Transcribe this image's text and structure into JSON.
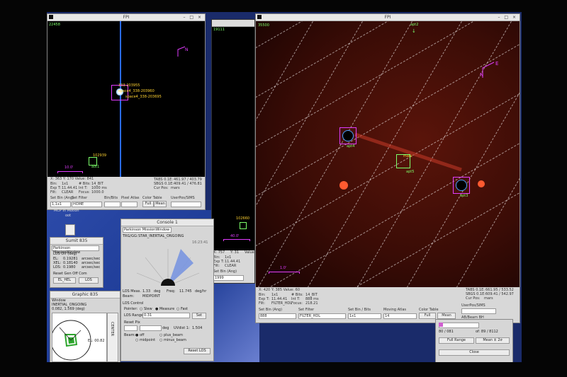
{
  "windows": {
    "fpi_left": {
      "title": "FPI",
      "counter": "22458",
      "targets": [
        "333-203955",
        "space4_338-203960",
        "space4_338-203695"
      ],
      "marker_a": "102939",
      "marker_b": "aot1",
      "scale": "10.0'",
      "info_line": "X:  363      Y:  170      Value: 841",
      "sbin": "Bin:",
      "sbin_val": "1x1",
      "sbits": "# Bits:",
      "sbits_val": "14_BIT",
      "sexp": "Exp T:",
      "sexp_val": "11.44.41",
      "sint": "Int T:",
      "sint_val": "1000 ms",
      "sfil": "Filt:",
      "sfil_val": "CLEAR",
      "sfocus": "Focus:",
      "sfocus_val": "1000.0",
      "sbj": "Cur Pos:",
      "sbj_val": "mars",
      "ra": "TABS 0.1E:",
      "ra_val": "461.97 / 403.79",
      "dec": "SBGS 0.1E:",
      "dec_val": "409.41 / 476.81",
      "set_bin": "Set Bin (Ang)",
      "set_bin_val": "1,1x1",
      "set_filter": "Set Filter",
      "set_filter_val": "HOME",
      "bin_bits": "Bin/Bits",
      "pixel": "Pixel Atlas",
      "color_table": "Color Table",
      "full": "Full",
      "mean": "Mean",
      "userpos": "UserPos/SIMS",
      "scroll": "MCP In Motion",
      "scroll2": "oot"
    },
    "narrow": {
      "counter": "19111",
      "marker_a": "102660",
      "scale": "40.0'",
      "x": "X:  757",
      "y": "Y:  31",
      "v": "Value",
      "bin": "Bin:",
      "bin_val": "1x1",
      "exp": "Exp T:",
      "exp_val": "11.44.41",
      "fil": "Filt:",
      "fil_val": "CLEAR",
      "set_bin": "Set Bin (Ang)",
      "set_bin_val": "1999"
    },
    "fpi_right": {
      "title": "FPI",
      "counter": "35500",
      "top_label": "apt2",
      "targets": [
        "apt4",
        "apt5",
        "apt3"
      ],
      "target_mars": "mars",
      "scale": "1.0'",
      "info_line": "X:  420      Y:  385      Value: 60",
      "bin": "Bin:",
      "bin_val": "1x1",
      "bits": "# Bits:",
      "bits_val": "14_BIT",
      "exp": "Exp T:",
      "exp_val": "11.44.41",
      "int": "Int T:",
      "int_val": "888 ms",
      "fil": "Filt:",
      "fil_val": "FILTER_HDL",
      "focus": "Focus:",
      "focus_val": "218.21",
      "ra": "TABS 0.1E:",
      "ra_val": "661.95 / 533.52",
      "dec": "SBGS 0.1E:",
      "dec_val": "609.41 / 542.97",
      "cur": "Cur Pos:",
      "cur_val": "mars",
      "set_bin": "Set Bin (Ang)",
      "set_bin_val": "888",
      "set_filter": "Set Filter",
      "set_filter_val": "FILTER_HDL",
      "bin_bits": "Set Bin / Bits",
      "bin_bits_val": "1x1",
      "moving": "Moving Atlas",
      "moving_val": "14",
      "color_table": "Color Table",
      "full": "Full",
      "mean": "Mean",
      "userpos": "UserPos/SIMS",
      "ab": "AB/Beam BH"
    },
    "console": {
      "title": "Console 1",
      "dropdown": "Parkinson MissionWindow",
      "lqs": "TRG/GG:",
      "lqs_val": "STAR_INERTIAL_ONGOING",
      "time": "16:23:41",
      "meas": "LOS Meas.",
      "meas_val": "1.33",
      "deg": "deg",
      "freq": "Freq:",
      "freq_val": "11.745",
      "freq_unit": "deg/hr",
      "beam": "Beam:",
      "beam_val": "MIDPOINT",
      "los": "LOS Control",
      "pointer": "Pointer:",
      "slew": "Slew",
      "measure": "Measure",
      "fast": "Fast",
      "range": "LOS Range",
      "range_val": "0.31",
      "set": "Set",
      "reset_pix": "Reset Pix",
      "beam2": "Beam:",
      "off": "off",
      "plus_beam": "plus_beam",
      "midpoint": "midpoint",
      "minus_beam": "minus_beam",
      "deg2": "deg",
      "uvdist": "UVdist 1:",
      "uvdist_val": "1.504",
      "reset_los": "Reset LOS"
    },
    "small": {
      "title": "Sumit 835",
      "dropdown": "Parkinson MissionWindow",
      "head": "LOS Off (deg)",
      "rows": [
        {
          "k": "EL:",
          "v": "0.19281",
          "u": "arcsec/sec"
        },
        {
          "k": "XEL:",
          "v": "0.18140",
          "u": "arcsec/sec"
        },
        {
          "k": "LOS:",
          "v": "0.1980",
          "u": "arcsec/sec"
        }
      ],
      "reset": "Reset Gen Off Com",
      "btn1": "EL_HEL",
      "btn2": "LOS"
    },
    "graphic": {
      "title": "Graphic 835",
      "win": "Window",
      "ongoing": "INERTIAL_ONGOING",
      "coords": "0.082, 1.569 (deg)",
      "el": "EL: 00.82",
      "center": "CENTER"
    },
    "range": {
      "field_a": "80 / 081",
      "field_b": "of: 89 / 8112",
      "full_range": "Full Range",
      "mean": "Mean ± 2σ",
      "close": "Close"
    }
  },
  "colors": {
    "target_magenta": "#e13cff",
    "label_yellow": "#ffd230",
    "label_green": "#7cff6a",
    "grid": "#ffffff"
  }
}
